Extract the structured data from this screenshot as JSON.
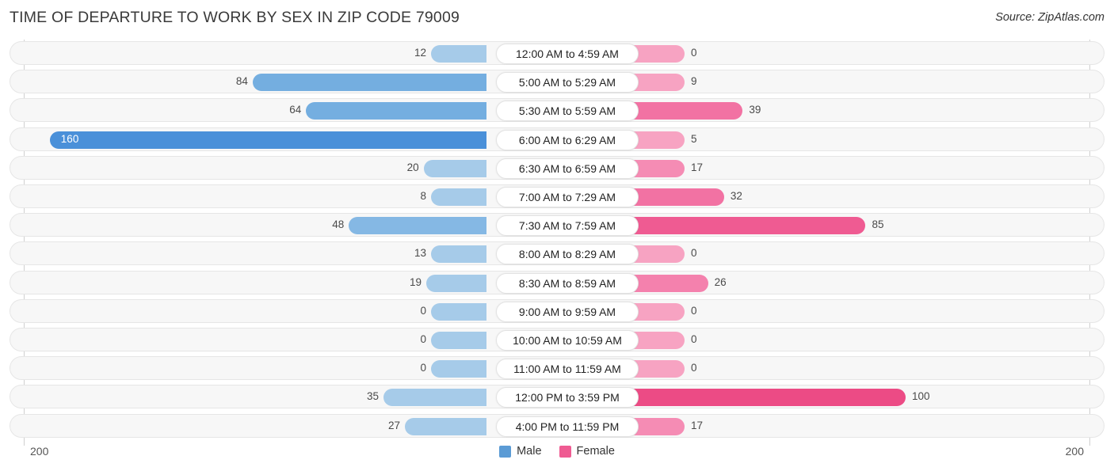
{
  "header": {
    "title": "TIME OF DEPARTURE TO WORK BY SEX IN ZIP CODE 79009",
    "source": "Source: ZipAtlas.com"
  },
  "axis": {
    "left_tick": "200",
    "right_tick": "200",
    "max": 200
  },
  "legend": {
    "items": [
      {
        "label": "Male",
        "color": "#5b9bd5"
      },
      {
        "label": "Female",
        "color": "#ef5b92"
      }
    ]
  },
  "chart_data": {
    "type": "bar",
    "title": "TIME OF DEPARTURE TO WORK BY SEX IN ZIP CODE 79009",
    "subtitle": "Source: ZipAtlas.com",
    "orientation": "horizontal-diverging",
    "xlabel": "",
    "ylabel": "",
    "xlim": [
      200,
      200
    ],
    "grid": false,
    "legend_position": "bottom-center",
    "categories": [
      "12:00 AM to 4:59 AM",
      "5:00 AM to 5:29 AM",
      "5:30 AM to 5:59 AM",
      "6:00 AM to 6:29 AM",
      "6:30 AM to 6:59 AM",
      "7:00 AM to 7:29 AM",
      "7:30 AM to 7:59 AM",
      "8:00 AM to 8:29 AM",
      "8:30 AM to 8:59 AM",
      "9:00 AM to 9:59 AM",
      "10:00 AM to 10:59 AM",
      "11:00 AM to 11:59 AM",
      "12:00 PM to 3:59 PM",
      "4:00 PM to 11:59 PM"
    ],
    "series": [
      {
        "name": "Male",
        "values": [
          12,
          84,
          64,
          160,
          20,
          8,
          48,
          13,
          19,
          0,
          0,
          0,
          35,
          27
        ]
      },
      {
        "name": "Female",
        "values": [
          0,
          9,
          39,
          5,
          17,
          32,
          85,
          0,
          26,
          0,
          0,
          0,
          100,
          17
        ]
      }
    ]
  },
  "rows": [
    {
      "label": "12:00 AM to 4:59 AM",
      "male": "12",
      "female": "0"
    },
    {
      "label": "5:00 AM to 5:29 AM",
      "male": "84",
      "female": "9"
    },
    {
      "label": "5:30 AM to 5:59 AM",
      "male": "64",
      "female": "39"
    },
    {
      "label": "6:00 AM to 6:29 AM",
      "male": "160",
      "female": "5"
    },
    {
      "label": "6:30 AM to 6:59 AM",
      "male": "20",
      "female": "17"
    },
    {
      "label": "7:00 AM to 7:29 AM",
      "male": "8",
      "female": "32"
    },
    {
      "label": "7:30 AM to 7:59 AM",
      "male": "48",
      "female": "85"
    },
    {
      "label": "8:00 AM to 8:29 AM",
      "male": "13",
      "female": "0"
    },
    {
      "label": "8:30 AM to 8:59 AM",
      "male": "19",
      "female": "26"
    },
    {
      "label": "9:00 AM to 9:59 AM",
      "male": "0",
      "female": "0"
    },
    {
      "label": "10:00 AM to 10:59 AM",
      "male": "0",
      "female": "0"
    },
    {
      "label": "11:00 AM to 11:59 AM",
      "male": "0",
      "female": "0"
    },
    {
      "label": "12:00 PM to 3:59 PM",
      "male": "35",
      "female": "100"
    },
    {
      "label": "4:00 PM to 11:59 PM",
      "male": "27",
      "female": "17"
    }
  ]
}
